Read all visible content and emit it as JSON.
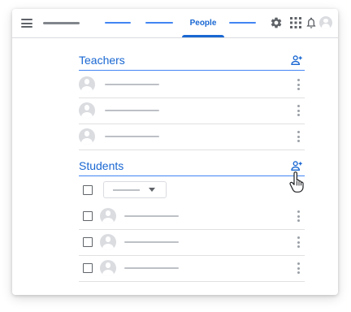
{
  "header": {
    "tabs": [
      {
        "label": ""
      },
      {
        "label": ""
      },
      {
        "label": "People",
        "active": true
      },
      {
        "label": ""
      }
    ],
    "icons": [
      "menu-icon",
      "settings-icon",
      "apps-grid-icon",
      "notifications-bell-icon",
      "account-avatar"
    ]
  },
  "teachers": {
    "title": "Teachers",
    "add_icon": "add-person-icon",
    "rows": [
      {
        "name": ""
      },
      {
        "name": ""
      },
      {
        "name": ""
      }
    ]
  },
  "students": {
    "title": "Students",
    "add_icon": "add-person-icon",
    "actions_select": {
      "value": ""
    },
    "rows": [
      {
        "name": "",
        "checked": false
      },
      {
        "name": "",
        "checked": false
      },
      {
        "name": "",
        "checked": false
      }
    ]
  },
  "colors": {
    "accent": "#1967d2",
    "tab_line": "#4285f4",
    "divider": "#e0e0e0",
    "icon_grey": "#5f6368",
    "avatar_grey": "#dadce0"
  }
}
